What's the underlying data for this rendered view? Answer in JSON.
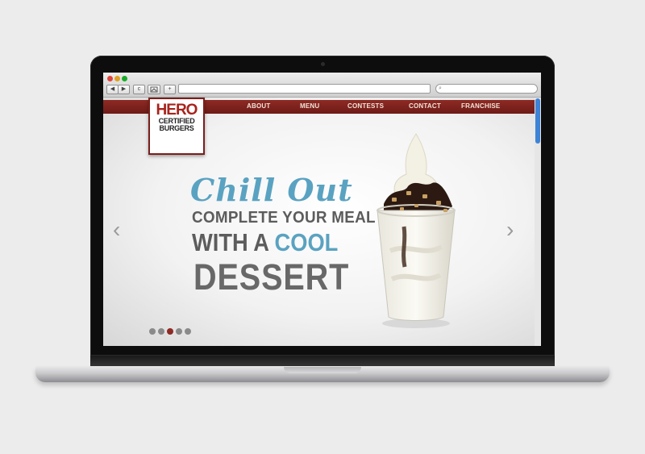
{
  "site": {
    "logo": {
      "line1": "HERO",
      "line2": "CERTIFIED",
      "line3": "BURGERS"
    },
    "nav": [
      "ABOUT",
      "MENU",
      "CONTESTS",
      "CONTACT",
      "FRANCHISE"
    ],
    "hero": {
      "headline": "Chill Out",
      "line2": "COMPLETE YOUR MEAL",
      "line3_part1": "WITH A ",
      "line3_part2": "COOL",
      "line4": "DESSERT"
    },
    "carousel": {
      "prev_arrow": "‹",
      "next_arrow": "›",
      "slides": 5,
      "active_index": 2
    }
  },
  "browser": {
    "back": "◀",
    "forward": "▶",
    "reload": "c",
    "add": "+",
    "search_glyph": "⌕"
  },
  "colors": {
    "brand_red": "#8e2a24",
    "accent_blue": "#5aa2c1",
    "text_gray": "#5c5c5c"
  }
}
